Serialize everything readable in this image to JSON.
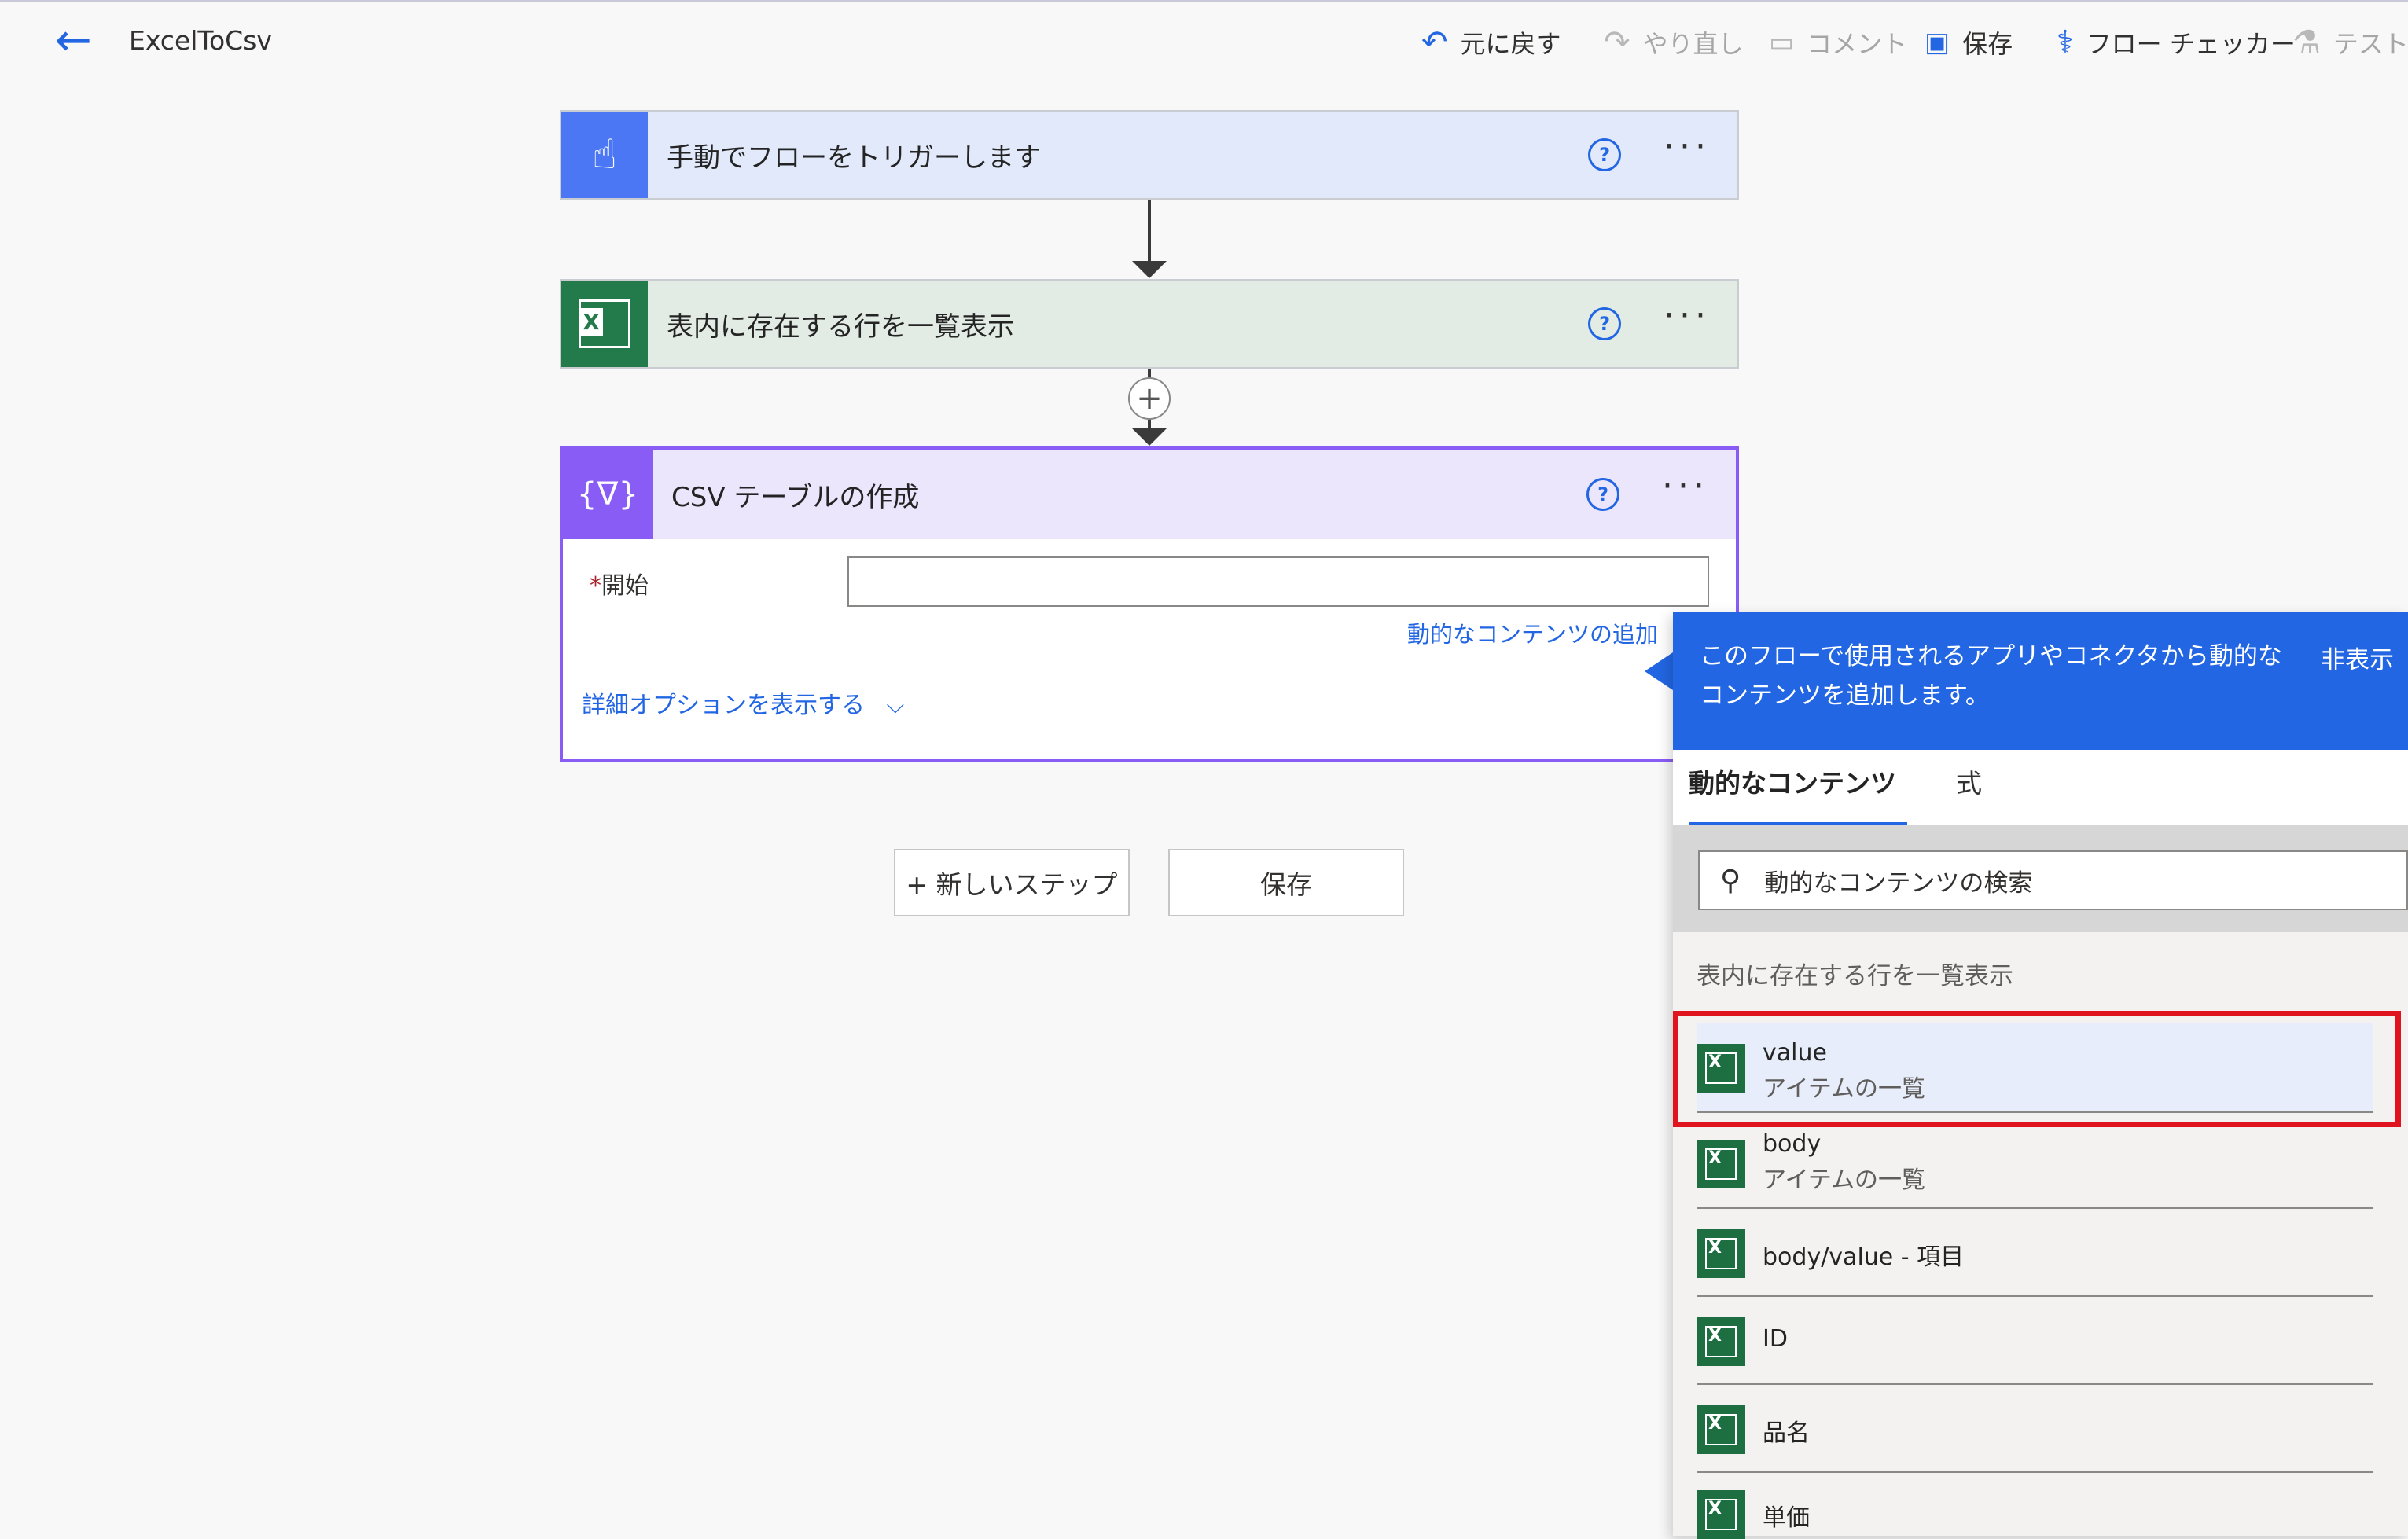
{
  "header": {
    "back_label": "←",
    "flow_name": "ExcelToCsv",
    "toolbar": {
      "undo": "元に戻す",
      "redo": "やり直し",
      "comment": "コメント",
      "save": "保存",
      "flow_checker": "フロー チェッカー",
      "test": "テスト"
    }
  },
  "steps": [
    {
      "title": "手動でフローをトリガーします",
      "color": "#4b77f5"
    },
    {
      "title": "表内に存在する行を一覧表示",
      "color": "#237b4b"
    },
    {
      "title": "CSV テーブルの作成",
      "color": "#8a5cf6"
    }
  ],
  "csv_step": {
    "required_mark": "*",
    "from_label": "開始",
    "from_value": "",
    "add_dynamic_link": "動的なコンテンツの追加",
    "advanced_options": "詳細オプションを表示する"
  },
  "actions": {
    "new_step": "+ 新しいステップ",
    "save": "保存"
  },
  "dynamic_panel": {
    "description": "このフローで使用されるアプリやコネクタから動的なコンテンツを追加します。",
    "hide": "非表示",
    "tabs": [
      "動的なコンテンツ",
      "式"
    ],
    "search_placeholder": "動的なコンテンツの検索",
    "section": "表内に存在する行を一覧表示",
    "items": [
      {
        "name": "value",
        "desc": "アイテムの一覧",
        "highlighted": true
      },
      {
        "name": "body",
        "desc": "アイテムの一覧"
      },
      {
        "name": "body/value - 項目",
        "desc": ""
      },
      {
        "name": "ID",
        "desc": ""
      },
      {
        "name": "品名",
        "desc": ""
      },
      {
        "name": "単価",
        "desc": ""
      }
    ]
  },
  "colors": {
    "accent": "#2266e3",
    "highlight_border": "#e0141e",
    "trigger_header": "#e1e9fb",
    "excel_header": "#e3ece4",
    "csv_header": "#ece6fd"
  }
}
